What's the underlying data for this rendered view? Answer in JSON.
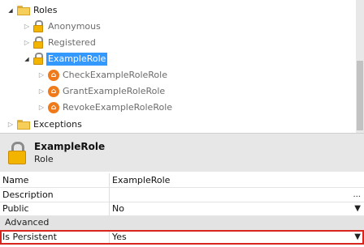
{
  "tree": {
    "roles_folder": "Roles",
    "items": [
      {
        "label": "Anonymous"
      },
      {
        "label": "Registered"
      },
      {
        "label": "ExampleRole"
      }
    ],
    "permissions": [
      {
        "label": "CheckExampleRoleRole"
      },
      {
        "label": "GrantExampleRoleRole"
      },
      {
        "label": "RevokeExampleRoleRole"
      }
    ],
    "exceptions_folder": "Exceptions"
  },
  "header": {
    "title": "ExampleRole",
    "subtitle": "Role"
  },
  "properties": {
    "name_label": "Name",
    "name_value": "ExampleRole",
    "description_label": "Description",
    "description_value": "",
    "description_button": "...",
    "public_label": "Public",
    "public_value": "No",
    "group_label": "Advanced",
    "persistent_label": "Is Persistent",
    "persistent_value": "Yes"
  },
  "icons": {
    "collapsed_arrow": "▷",
    "expanded_arrow": "◢",
    "dropdown_arrow": "▼"
  },
  "colors": {
    "selection": "#3399ff",
    "highlight_border": "#d9261c",
    "permission_icon": "#f07a1a",
    "lock_body": "#f3b400"
  }
}
